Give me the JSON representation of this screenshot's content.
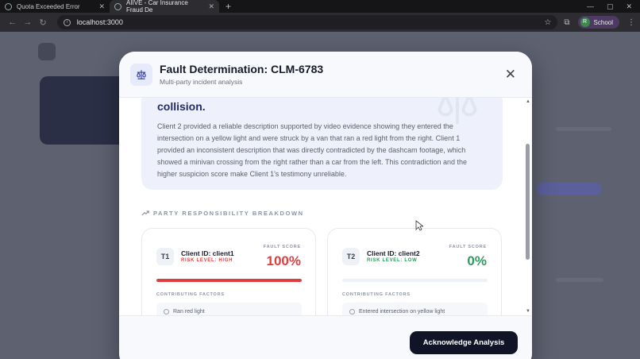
{
  "browser": {
    "tabs": [
      {
        "title": "Quota Exceeded Error",
        "active": false
      },
      {
        "title": "AIIVE - Car Insurance Fraud De",
        "active": true
      }
    ],
    "new_tab_glyph": "+",
    "url": "localhost:3000",
    "profile_initial": "R",
    "profile_label": "School",
    "colors": {
      "chrome": "#2c2c31",
      "tabbar": "#151517",
      "profile": "#4d3a63"
    }
  },
  "modal": {
    "title": "Fault Determination: CLM-6783",
    "subtitle": "Multi-party incident analysis",
    "close_glyph": "✕",
    "icon": "scale-icon",
    "summary": {
      "heading_tail": "collision.",
      "text": "Client 2 provided a reliable description supported by video evidence showing they entered the intersection on a yellow light and were struck by a van that ran a red light from the right. Client 1 provided an inconsistent description that was directly contradicted by the dashcam footage, which showed a minivan crossing from the right rather than a car from the left. This contradiction and the higher suspicion score make Client 1's testimony unreliable."
    },
    "section_label": "PARTY RESPONSIBILITY BREAKDOWN",
    "parties": [
      {
        "badge": "T1",
        "client_id": "Client ID: client1",
        "risk_level": "RISK LEVEL: HIGH",
        "fault_score_label": "FAULT SCORE",
        "fault_score": "100%",
        "fault_fraction": 1.0,
        "factors_label": "CONTRIBUTING FACTORS",
        "factors": [
          "Ran red light"
        ],
        "color": "#e03e3e"
      },
      {
        "badge": "T2",
        "client_id": "Client ID: client2",
        "risk_level": "RISK LEVEL: LOW",
        "fault_score_label": "FAULT SCORE",
        "fault_score": "0%",
        "fault_fraction": 0.0,
        "factors_label": "CONTRIBUTING FACTORS",
        "factors": [
          "Entered intersection on yellow light"
        ],
        "color": "#2f9a5e"
      }
    ],
    "acknowledge_label": "Acknowledge Analysis",
    "colors": {
      "heading": "#232b63",
      "summary_bg": "#eef1fb",
      "button": "#101426"
    }
  }
}
